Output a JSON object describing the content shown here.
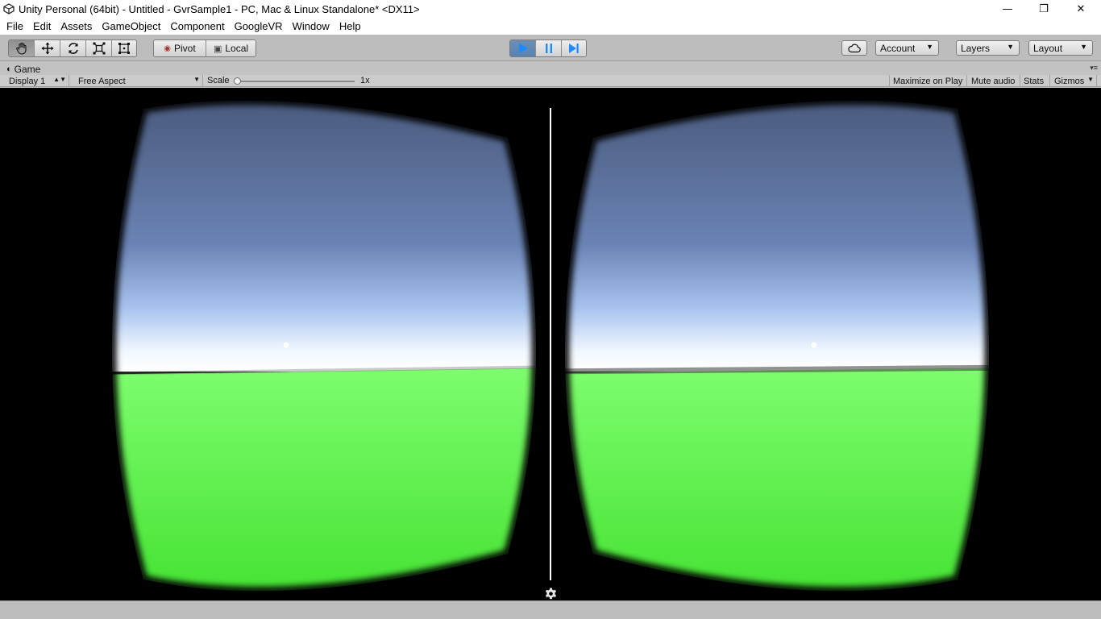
{
  "window": {
    "title": "Unity Personal (64bit) - Untitled - GvrSample1 - PC, Mac & Linux Standalone* <DX11>",
    "controls": {
      "minimize": "—",
      "restore": "❐",
      "close": "✕"
    }
  },
  "menu": [
    "File",
    "Edit",
    "Assets",
    "GameObject",
    "Component",
    "GoogleVR",
    "Window",
    "Help"
  ],
  "toolbar": {
    "transform_tools": [
      "hand-tool",
      "move-tool",
      "rotate-tool",
      "scale-tool",
      "rect-tool"
    ],
    "pivot_label": "Pivot",
    "local_label": "Local",
    "playback": {
      "play": "play",
      "pause": "pause",
      "step": "step",
      "play_state": "playing"
    },
    "account_label": "Account",
    "layers_label": "Layers",
    "layout_label": "Layout"
  },
  "game_tab": {
    "label": "Game",
    "display_label": "Display 1",
    "aspect_label": "Free Aspect",
    "scale_label": "Scale",
    "scale_value": "1x",
    "scale_fraction": 0.0,
    "maximize_label": "Maximize on Play",
    "mute_label": "Mute audio",
    "stats_label": "Stats",
    "gizmos_label": "Gizmos"
  },
  "scene": {
    "sky_top": "#4c5e82",
    "sky_mid": "#7c95c4",
    "horizon": "#ffffff",
    "ground_top": "#7cfc6c",
    "ground_bottom": "#45e234",
    "divider_color": "#ffffff"
  }
}
